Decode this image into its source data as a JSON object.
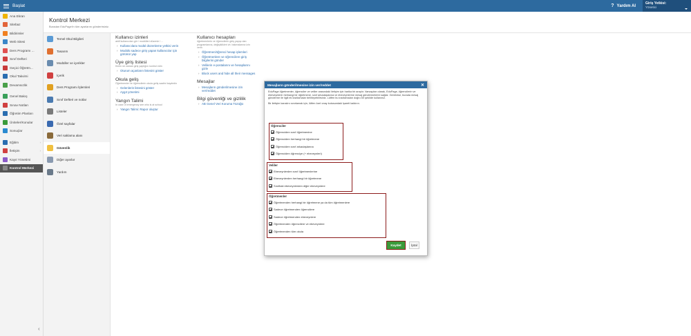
{
  "topbar": {
    "start": "Başlat",
    "help": "Yardım AI",
    "login_label": "Giriş Yetkisi:",
    "login_value": "Yönetici"
  },
  "sidebar": {
    "items": [
      {
        "label": "Ana Ekran",
        "color": "#f0b400"
      },
      {
        "label": "Sitebaz",
        "color": "#e2643a"
      },
      {
        "label": "Bildirimler",
        "color": "#f08020"
      },
      {
        "label": "Web Sitesi",
        "color": "#3a86c8"
      },
      {
        "label": "Ders Programı ...",
        "color": "#e05050"
      },
      {
        "label": "Sınıf Defteri",
        "color": "#d04040"
      },
      {
        "label": "Geçici Öğretm...",
        "color": "#c83a3a"
      },
      {
        "label": "Okul Takvimi",
        "color": "#2a6db0"
      },
      {
        "label": "Devamsızlık",
        "color": "#4aa04a"
      },
      {
        "label": "Genel Bakış",
        "color": "#3aa05a"
      },
      {
        "label": "Sınav Notları",
        "color": "#d04040"
      },
      {
        "label": "Öğretim Planları",
        "color": "#2a6db0"
      },
      {
        "label": "Üniteler/Konular",
        "color": "#3a9a3a"
      },
      {
        "label": "Sonuçlar",
        "color": "#2a8ad0"
      },
      {
        "label": "Eğitim",
        "color": "#2a6db0"
      },
      {
        "label": "İletişim",
        "color": "#d04040"
      },
      {
        "label": "Kayıt Yönetimi",
        "color": "#8a5ac8"
      },
      {
        "label": "Kontrol Merkezi",
        "color": "#888888"
      }
    ]
  },
  "header": {
    "title": "Kontrol Merkezi",
    "subtitle": "Buradan EduPage'in tüm ayarlarını gönderirsiniz."
  },
  "categories": [
    {
      "label": "Temel Okul Bilgileri",
      "color": "#5b9bd5"
    },
    {
      "label": "Tasarım",
      "color": "#e07030"
    },
    {
      "label": "Modüller ve içerikler",
      "color": "#6a8caf"
    },
    {
      "label": "İçerik",
      "color": "#d04040"
    },
    {
      "label": "Ders Programı İşlemleri",
      "color": "#e0a020"
    },
    {
      "label": "Sınıf Defteri ve notlar",
      "color": "#4a7ab0"
    },
    {
      "label": "Listeler",
      "color": "#7a7a7a"
    },
    {
      "label": "Özel sayfalar",
      "color": "#3a6ab0"
    },
    {
      "label": "Veri saklama alanı",
      "color": "#8a6a3a"
    },
    {
      "label": "Güvenlik",
      "color": "#f0c040"
    },
    {
      "label": "Diğer ayarlar",
      "color": "#8a9ab0"
    },
    {
      "label": "Yardım",
      "color": "#6a7a8a"
    }
  ],
  "col1": [
    {
      "title": "Kullanıcı izinleri",
      "desc": "aktif kullanıcıları gör / modülleri düzenle / ...",
      "links": [
        "Kullanıcılara modül düzenleme yetkisi verin",
        "Modülü sadece giriş yapan kullanıcılar için görünür yap"
      ]
    },
    {
      "title": "Üye giriş listesi",
      "desc": "Kimin ne zaman giriş yaptığını kontrol edin",
      "links": [
        "Oturum açanların listesini göster"
      ]
    },
    {
      "title": "Okula geliş",
      "desc": "Öğretmenler ve öğrencilerin okula geliş saatini kaydedin",
      "links": [
        "Gelenlerin listesini göster",
        "Aygıt yönetimi"
      ]
    },
    {
      "title": "Yangın Talimi",
      "desc": "In case of emergency see who is at school",
      "links": [
        "Yangın Talimi: Rapor oluştur"
      ]
    }
  ],
  "col2": [
    {
      "title": "Kullanıcı hesapları",
      "desc": "öğretmenlerin ve öğrencilerin giriş yapışı dan programlarına, değişiklikleri vb. bakmalarına izin verin",
      "links": [
        "Öğretmen/öğrenci hesap işlemleri",
        "Öğretmenlere ve öğrencilere giriş bilgilerini gönder",
        "Velilerin e-postalarını ve hesaplarını gizle",
        "Block users and hide all their messages"
      ]
    },
    {
      "title": "Mesajlar",
      "desc": "",
      "links": [
        "Mesajların gönderilmesine izin ver/reddet"
      ]
    },
    {
      "title": "Bilgi güvenliği ve gizlilik",
      "desc": "",
      "links": [
        "AB Genel Veri Koruma Tüzüğü"
      ]
    }
  ],
  "dialog": {
    "title": "Mesajların gönderilmesine izin ver/reddet",
    "intro": "EduPage öğretmenler, öğrenciler ve veliler arasındaki iletişim için harika bir araçtır. Varsayılan olarak, EduPage, öğrencilerin ve ebeveynlerin herhangi bir öğretmene, sınıf arkadaşlarına ve ebeveynlerine mesaj göndermelerini sağlar. Gerekirse, burada mesaj gönderme ile ilgili ek kısıtlamalar belirleyebilirsiniz. Lütfen bu kısıtlamaları doğru bir şekilde kullanınız.",
    "note": "Bir iletişim kanalını sınırlamak için, lütfen özel onay kutusundaki işareti kaldırın.",
    "students": {
      "title": "Öğrenciler",
      "items": [
        "Öğrenciden sınıf öğretmenine",
        "Öğrenciden herhangi bir öğretmene",
        "Öğrenciden sınıf arkadaşlarına",
        "Öğrenciden öğrenciye (+ ebeveynleri)"
      ]
    },
    "parents": {
      "title": "Veliler",
      "items": [
        "Ebeveynlerden sınıf öğretmenlerine",
        "Ebeveynlerden herhangi bir öğretmene",
        "Sınıftaki ebeveynlerden diğer ebeveynlere"
      ]
    },
    "teachers": {
      "title": "Öğretmenler",
      "items": [
        "Öğretmenden herhangi bir öğretmene ya da tüm öğretmenlere",
        "Sadece öğretmenden öğrencilere",
        "Sadece öğretmenden ebeveynlere",
        "Öğretmenden öğrencilere ve ebeveynlere",
        "Öğretmenden tüm okula"
      ]
    },
    "save": "Kaydet",
    "cancel": "İptal"
  }
}
